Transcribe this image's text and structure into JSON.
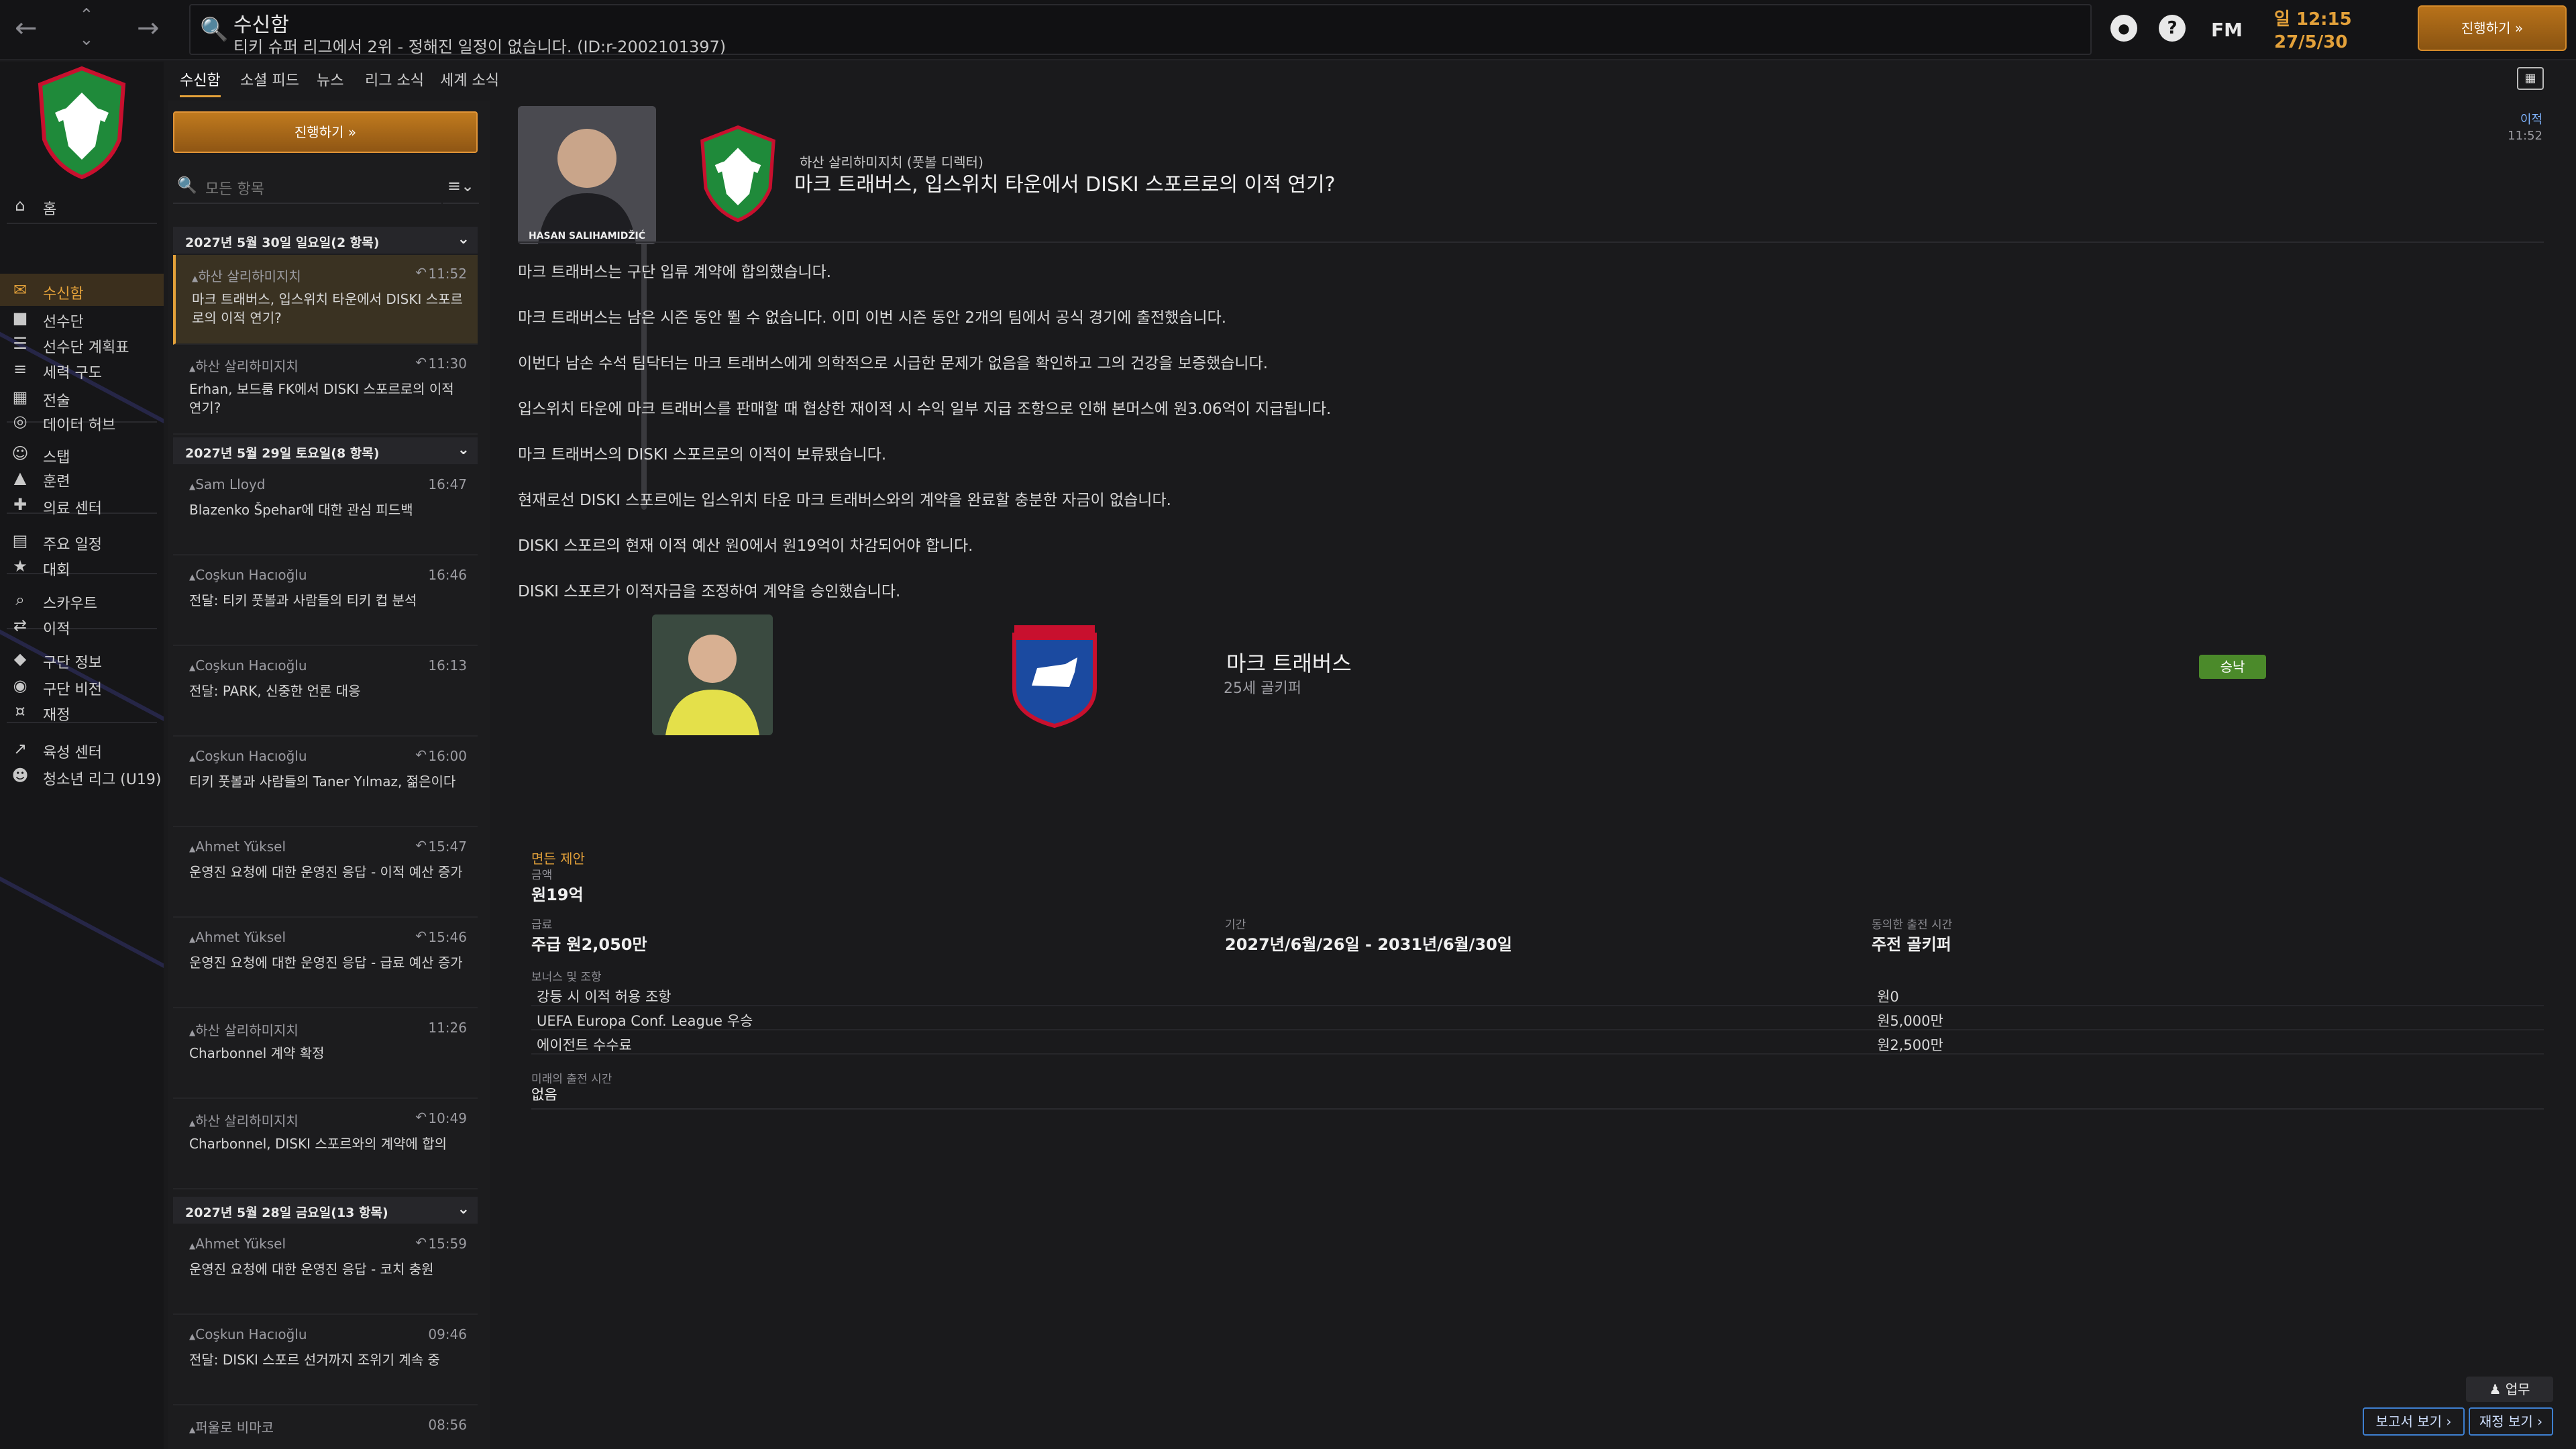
{
  "topbar": {
    "page_title": "수신함",
    "subtitle": "티키 슈퍼 리그에서 2위 - 정해진 일정이 없습니다. (ID:r-2002101397)",
    "fm_label": "FM",
    "clock_time": "일 12:15",
    "clock_date": "27/5/30",
    "continue_label": "진행하기 »"
  },
  "sidebar": {
    "items": [
      {
        "label": "홈",
        "icon": "home-icon"
      },
      {
        "label": "수신함",
        "icon": "inbox-icon",
        "active": true
      },
      {
        "label": "선수단",
        "icon": "shirt-icon"
      },
      {
        "label": "선수단 계획표",
        "icon": "clipboard-icon"
      },
      {
        "label": "세력 구도",
        "icon": "hierarchy-icon"
      },
      {
        "label": "전술",
        "icon": "tactics-icon"
      },
      {
        "label": "데이터 허브",
        "icon": "data-hub-icon"
      },
      {
        "label": "스탭",
        "icon": "staff-icon"
      },
      {
        "label": "훈련",
        "icon": "training-icon"
      },
      {
        "label": "의료 센터",
        "icon": "medical-icon"
      },
      {
        "label": "주요 일정",
        "icon": "calendar-icon"
      },
      {
        "label": "대회",
        "icon": "trophy-icon"
      },
      {
        "label": "스카우트",
        "icon": "scout-icon"
      },
      {
        "label": "이적",
        "icon": "transfer-icon"
      },
      {
        "label": "구단 정보",
        "icon": "club-info-icon"
      },
      {
        "label": "구단 비전",
        "icon": "club-vision-icon"
      },
      {
        "label": "재정",
        "icon": "finance-icon"
      },
      {
        "label": "육성 센터",
        "icon": "development-icon"
      },
      {
        "label": "청소년 리그 (U19)",
        "icon": "youth-icon"
      }
    ]
  },
  "subtabs": [
    "수신함",
    "소셜 피드",
    "뉴스",
    "리그 소식",
    "세계 소식"
  ],
  "inbox": {
    "continue_label": "진행하기 »",
    "search_placeholder": "모든 항목",
    "days": [
      {
        "header": "2027년 5월 30일 일요일(2 항목)"
      },
      {
        "header": "2027년 5월 29일 토요일(8 항목)"
      },
      {
        "header": "2027년 5월 28일 금요일(13 항목)"
      }
    ],
    "messages": [
      {
        "from": "하산 살리하미지치",
        "time": "11:52",
        "subject": "마크 트래버스, 입스위치 타운에서 DISKI 스포르로의 이적 연기?"
      },
      {
        "from": "하산 살리하미지치",
        "time": "11:30",
        "subject": "Erhan, 보드룸 FK에서 DISKI 스포르로의 이적 연기?"
      },
      {
        "from": "Sam Lloyd",
        "time": "16:47",
        "subject": "Blazenko Špehar에 대한 관심 피드백"
      },
      {
        "from": "Coşkun Hacıoğlu",
        "time": "16:46",
        "subject": "전달: 티키 풋볼과 사람들의 티키 컵 분석"
      },
      {
        "from": "Coşkun Hacıoğlu",
        "time": "16:13",
        "subject": "전달: PARK, 신중한 언론 대응"
      },
      {
        "from": "Coşkun Hacıoğlu",
        "time": "16:00",
        "subject": "티키 풋볼과 사람들의 Taner Yılmaz, 젊은이다"
      },
      {
        "from": "Ahmet Yüksel",
        "time": "15:47",
        "subject": "운영진 요청에 대한 운영진 응답 - 이적 예산 증가"
      },
      {
        "from": "Ahmet Yüksel",
        "time": "15:46",
        "subject": "운영진 요청에 대한 운영진 응답 - 급료 예산 증가"
      },
      {
        "from": "하산 살리하미지치",
        "time": "11:26",
        "subject": "Charbonnel 계약 확정"
      },
      {
        "from": "하산 살리하미지치",
        "time": "10:49",
        "subject": "Charbonnel, DISKI 스포르와의 계약에 합의"
      },
      {
        "from": "Ahmet Yüksel",
        "time": "15:59",
        "subject": "운영진 요청에 대한 운영진 응답 - 코치 충원"
      },
      {
        "from": "Coşkun Hacıoğlu",
        "time": "09:46",
        "subject": "전달: DISKI 스포르 선거까지 조위기 계속 중"
      },
      {
        "from": "퍼울로 비마코",
        "time": "08:56",
        "subject": ""
      }
    ]
  },
  "message": {
    "photo_caption": "HASAN SALIHAMIDŽIĆ",
    "from": "하산 살리하미지치 (풋볼 디렉터)",
    "title": "마크 트래버스, 입스위치 타운에서 DISKI 스포르로의 이적 연기?",
    "tag": "이적",
    "time": "11:52",
    "body": [
      "마크 트래버스는 구단 입류 계약에 합의했습니다.",
      "마크 트래버스는 남은 시즌 동안 뛸 수 없습니다. 이미 이번 시즌 동안 2개의 팀에서 공식 경기에 출전했습니다.",
      "이번다 남손 수석 팀닥터는 마크 트래버스에게 의학적으로 시급한 문제가 없음을 확인하고 그의 건강을 보증했습니다.",
      "입스위치 타운에 마크 트래버스를 판매할 때 협상한 재이적 시 수익 일부 지급 조항으로 인해 본머스에 원3.06억이 지급됩니다.",
      "마크 트래버스의 DISKI 스포르로의 이적이 보류됐습니다.",
      "현재로선 DISKI 스포르에는 입스위치 타운 마크 트래버스와의 계약을 완료할 충분한 자금이 없습니다.",
      "DISKI 스포르의 현재 이적 예산 원0에서 원19억이 차감되어야 합니다.",
      "DISKI 스포르가 이적자금을 조정하여 계약을 승인했습니다."
    ]
  },
  "card": {
    "player_name": "마크 트래버스",
    "player_desc": "25세 골키퍼",
    "approve_label": "승낙",
    "release_label": "면든 제안",
    "fee_label": "금액",
    "fee_value": "원19억",
    "wage_label": "급료",
    "wage_value": "주급 원2,050만",
    "period_label": "기간",
    "period_value": "2027년/6월/26일 - 2031년/6월/30일",
    "role_label": "동의한 출전 시간",
    "role_value": "주전 골키퍼",
    "bonus_label": "보너스 및 조항",
    "bonuses": [
      {
        "label": "강등 시 이적 허용 조항",
        "value": "원0"
      },
      {
        "label": "UEFA Europa Conf. League 우승",
        "value": "원5,000만"
      },
      {
        "label": "에이전트 수수료",
        "value": "원2,500만"
      }
    ],
    "future_label": "미래의 출전 시간",
    "future_value": "없음"
  },
  "footer": {
    "work_label": "업무",
    "report_label": "보고서 보기 ›",
    "finance_label": "재정 보기 ›"
  },
  "colors": {
    "accent": "#e3a13a",
    "approve": "#4b8a2a",
    "link": "#3e7fcf"
  }
}
